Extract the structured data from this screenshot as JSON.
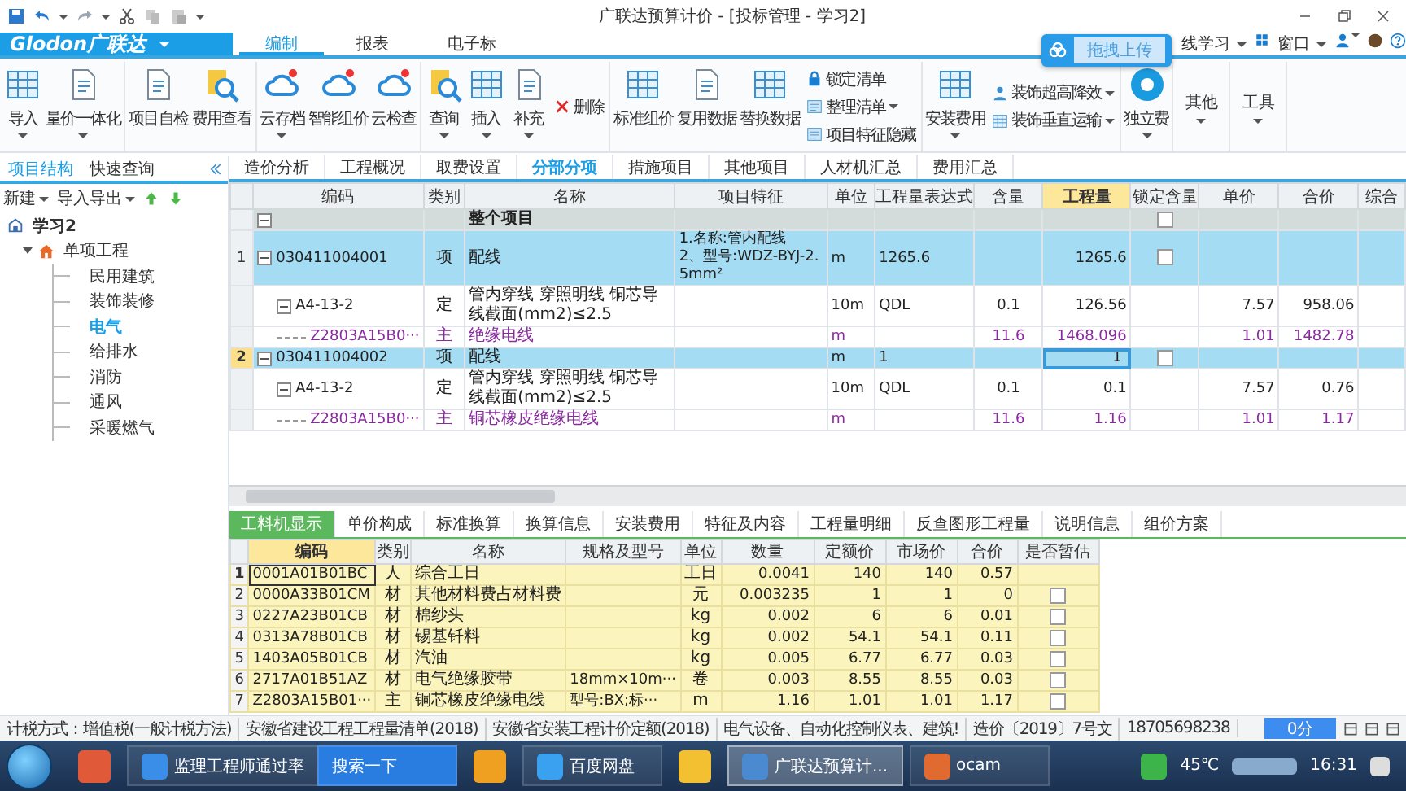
{
  "titlebar": {
    "title": "广联达预算计价 - [投标管理 - 学习2]"
  },
  "ribbon": {
    "logo": "Glodon广联达",
    "tabs": [
      {
        "label": "编制",
        "selected": true
      },
      {
        "label": "报表",
        "selected": false
      },
      {
        "label": "电子标",
        "selected": false
      }
    ],
    "right_links": [
      {
        "label": "线学习",
        "dropdown": true
      },
      {
        "label": "窗口",
        "dropdown": true
      }
    ],
    "upload_popup": "拖拽上传",
    "groups": [
      {
        "items": [
          {
            "kind": "large",
            "label": "导入",
            "dropdown": true
          },
          {
            "kind": "large",
            "label": "量价一体化",
            "dropdown": true
          }
        ]
      },
      {
        "items": [
          {
            "kind": "large",
            "label": "项目自检",
            "dropdown": false
          },
          {
            "kind": "large",
            "label": "费用查看",
            "dropdown": false
          }
        ]
      },
      {
        "items": [
          {
            "kind": "large",
            "label": "云存档",
            "dropdown": true
          },
          {
            "kind": "large",
            "label": "智能组价",
            "dropdown": false
          },
          {
            "kind": "large",
            "label": "云检查",
            "dropdown": false
          }
        ]
      },
      {
        "items": [
          {
            "kind": "large",
            "label": "查询",
            "dropdown": true
          },
          {
            "kind": "large",
            "label": "插入",
            "dropdown": true
          },
          {
            "kind": "large",
            "label": "补充",
            "dropdown": true
          },
          {
            "kind": "stack",
            "items": [
              {
                "label": "删除",
                "dropdown": false
              }
            ]
          }
        ]
      },
      {
        "items": [
          {
            "kind": "large",
            "label": "标准组价",
            "dropdown": false
          },
          {
            "kind": "large",
            "label": "复用数据",
            "dropdown": false
          },
          {
            "kind": "large",
            "label": "替换数据",
            "dropdown": false
          },
          {
            "kind": "stack",
            "items": [
              {
                "label": "锁定清单",
                "dropdown": false
              },
              {
                "label": "整理清单",
                "dropdown": true
              },
              {
                "label": "项目特征隐藏",
                "dropdown": false
              }
            ]
          }
        ]
      },
      {
        "items": [
          {
            "kind": "large",
            "label": "安装费用",
            "dropdown": true
          },
          {
            "kind": "stack",
            "items": [
              {
                "label": "装饰超高降效",
                "dropdown": true
              },
              {
                "label": "装饰垂直运输",
                "dropdown": true
              }
            ]
          }
        ]
      },
      {
        "items": [
          {
            "kind": "large",
            "label": "独立费",
            "dropdown": true
          }
        ]
      },
      {
        "items": [
          {
            "kind": "text",
            "label": "其他",
            "dropdown": true
          }
        ]
      },
      {
        "items": [
          {
            "kind": "text",
            "label": "工具",
            "dropdown": true
          }
        ]
      }
    ]
  },
  "sidebar": {
    "tabs": [
      {
        "label": "项目结构",
        "selected": true
      },
      {
        "label": "快速查询",
        "selected": false
      }
    ],
    "tools": [
      {
        "label": "新建",
        "dropdown": true
      },
      {
        "label": "导入导出",
        "dropdown": true
      }
    ],
    "tree": [
      {
        "label": "学习2",
        "selected": false,
        "children": [
          {
            "label": "单项工程",
            "selected": false,
            "children": [
              {
                "label": "民用建筑",
                "selected": false
              },
              {
                "label": "装饰装修",
                "selected": false
              },
              {
                "label": "电气",
                "selected": true
              },
              {
                "label": "给排水",
                "selected": false
              },
              {
                "label": "消防",
                "selected": false
              },
              {
                "label": "通风",
                "selected": false
              },
              {
                "label": "采暖燃气",
                "selected": false
              }
            ]
          }
        ]
      }
    ]
  },
  "main": {
    "tabs": [
      {
        "label": "造价分析",
        "selected": false
      },
      {
        "label": "工程概况",
        "selected": false
      },
      {
        "label": "取费设置",
        "selected": false
      },
      {
        "label": "分部分项",
        "selected": true
      },
      {
        "label": "措施项目",
        "selected": false
      },
      {
        "label": "其他项目",
        "selected": false
      },
      {
        "label": "人材机汇总",
        "selected": false
      },
      {
        "label": "费用汇总",
        "selected": false
      }
    ],
    "columns": [
      {
        "label": "编码",
        "highlighted": false
      },
      {
        "label": "类别",
        "highlighted": false
      },
      {
        "label": "名称",
        "highlighted": false
      },
      {
        "label": "项目特征",
        "highlighted": false
      },
      {
        "label": "单位",
        "highlighted": false
      },
      {
        "label": "工程量表达式",
        "highlighted": false
      },
      {
        "label": "含量",
        "highlighted": false
      },
      {
        "label": "工程量",
        "highlighted": true
      },
      {
        "label": "锁定含量",
        "highlighted": false
      },
      {
        "label": "单价",
        "highlighted": false
      },
      {
        "label": "合价",
        "highlighted": false
      },
      {
        "label": "综合",
        "highlighted": false
      }
    ],
    "rows": [
      {
        "kind": "group",
        "name": "整个项目",
        "locked": false,
        "selected": false
      },
      {
        "kind": "item",
        "number": "1",
        "code": "030411004001",
        "type": "项",
        "name": "配线",
        "feature": "1.名称:管内配线\n2、型号:WDZ-BYJ-2.5mm²",
        "unit": "m",
        "expression": "1265.6",
        "quantity": "1265.6",
        "locked": false,
        "selected": false
      },
      {
        "kind": "quota",
        "code": "A4-13-2",
        "type": "定",
        "name": "管内穿线 穿照明线 铜芯导线截面(mm2)≤2.5",
        "unit": "10m",
        "expression": "QDL",
        "content": "0.1",
        "quantity": "126.56",
        "unit_price": "7.57",
        "total": "958.06",
        "selected": false
      },
      {
        "kind": "material",
        "code": "Z2803A15B0···",
        "type": "主",
        "name": "绝缘电线",
        "unit": "m",
        "content": "11.6",
        "quantity": "1468.096",
        "unit_price": "1.01",
        "total": "1482.78",
        "selected": false
      },
      {
        "kind": "item",
        "number": "2",
        "code": "030411004002",
        "type": "项",
        "name": "配线",
        "unit": "m",
        "expression": "1",
        "quantity": "1",
        "locked": false,
        "selected": true
      },
      {
        "kind": "quota",
        "code": "A4-13-2",
        "type": "定",
        "name": "管内穿线 穿照明线 铜芯导线截面(mm2)≤2.5",
        "unit": "10m",
        "expression": "QDL",
        "content": "0.1",
        "quantity": "0.1",
        "unit_price": "7.57",
        "total": "0.76",
        "selected": false
      },
      {
        "kind": "material",
        "code": "Z2803A15B0···",
        "type": "主",
        "name": "铜芯橡皮绝缘电线",
        "unit": "m",
        "content": "11.6",
        "quantity": "1.16",
        "unit_price": "1.01",
        "total": "1.17",
        "selected": false
      }
    ]
  },
  "lower": {
    "tabs": [
      {
        "label": "工料机显示",
        "selected": true
      },
      {
        "label": "单价构成",
        "selected": false
      },
      {
        "label": "标准换算",
        "selected": false
      },
      {
        "label": "换算信息",
        "selected": false
      },
      {
        "label": "安装费用",
        "selected": false
      },
      {
        "label": "特征及内容",
        "selected": false
      },
      {
        "label": "工程量明细",
        "selected": false
      },
      {
        "label": "反查图形工程量",
        "selected": false
      },
      {
        "label": "说明信息",
        "selected": false
      },
      {
        "label": "组价方案",
        "selected": false
      }
    ],
    "columns": [
      {
        "label": "编码",
        "highlighted": true
      },
      {
        "label": "类别",
        "highlighted": false
      },
      {
        "label": "名称",
        "highlighted": false
      },
      {
        "label": "规格及型号",
        "highlighted": false
      },
      {
        "label": "单位",
        "highlighted": false
      },
      {
        "label": "数量",
        "highlighted": false
      },
      {
        "label": "定额价",
        "highlighted": false
      },
      {
        "label": "市场价",
        "highlighted": false
      },
      {
        "label": "合价",
        "highlighted": false
      },
      {
        "label": "是否暂估",
        "highlighted": false
      }
    ],
    "rows": [
      {
        "number": "1",
        "code": "0001A01B01BC",
        "type": "人",
        "name": "综合工日",
        "unit": "工日",
        "amount": "0.0041",
        "quota_price": "140",
        "market_price": "140",
        "total": "0.57",
        "selected": true
      },
      {
        "number": "2",
        "code": "0000A33B01CM",
        "type": "材",
        "name": "其他材料费占材料费",
        "unit": "元",
        "amount": "0.003235",
        "quota_price": "1",
        "market_price": "1",
        "total": "0",
        "provisional": false,
        "selected": false
      },
      {
        "number": "3",
        "code": "0227A23B01CB",
        "type": "材",
        "name": "棉纱头",
        "unit": "kg",
        "amount": "0.002",
        "quota_price": "6",
        "market_price": "6",
        "total": "0.01",
        "provisional": false,
        "selected": false
      },
      {
        "number": "4",
        "code": "0313A78B01CB",
        "type": "材",
        "name": "锡基钎料",
        "unit": "kg",
        "amount": "0.002",
        "quota_price": "54.1",
        "market_price": "54.1",
        "total": "0.11",
        "provisional": false,
        "selected": false
      },
      {
        "number": "5",
        "code": "1403A05B01CB",
        "type": "材",
        "name": "汽油",
        "unit": "kg",
        "amount": "0.005",
        "quota_price": "6.77",
        "market_price": "6.77",
        "total": "0.03",
        "provisional": false,
        "selected": false
      },
      {
        "number": "6",
        "code": "2717A01B51AZ",
        "type": "材",
        "name": "电气绝缘胶带",
        "spec": "18mm×10m···",
        "unit": "卷",
        "amount": "0.003",
        "quota_price": "8.55",
        "market_price": "8.55",
        "total": "0.03",
        "provisional": false,
        "selected": false
      },
      {
        "number": "7",
        "code": "Z2803A15B01···",
        "type": "主",
        "name": "铜芯橡皮绝缘电线",
        "spec": "型号:BX;标···",
        "unit": "m",
        "amount": "1.16",
        "quota_price": "1.01",
        "market_price": "1.01",
        "total": "1.17",
        "provisional": false,
        "selected": false
      }
    ]
  },
  "status_bar": {
    "items": [
      "计税方式：增值税(一般计税方法)",
      "安徽省建设工程工程量清单(2018)",
      "安徽省安装工程计价定额(2018)",
      "电气设备、自动化控制仪表、建筑!",
      "造价〔2019〕7号文",
      "18705698238"
    ],
    "score": "0分"
  },
  "taskbar": {
    "buttons": [
      {
        "kind": "browser",
        "label": "监理工程师通过率",
        "selected": false
      },
      {
        "kind": "search",
        "label": "搜索一下",
        "selected": false
      },
      {
        "kind": "app",
        "label": "百度网盘",
        "selected": false
      },
      {
        "kind": "app",
        "label": "广联达预算计...",
        "selected": true
      },
      {
        "kind": "app",
        "label": "ocam",
        "selected": false
      }
    ],
    "temperature": "45℃",
    "clock": "16:31"
  }
}
